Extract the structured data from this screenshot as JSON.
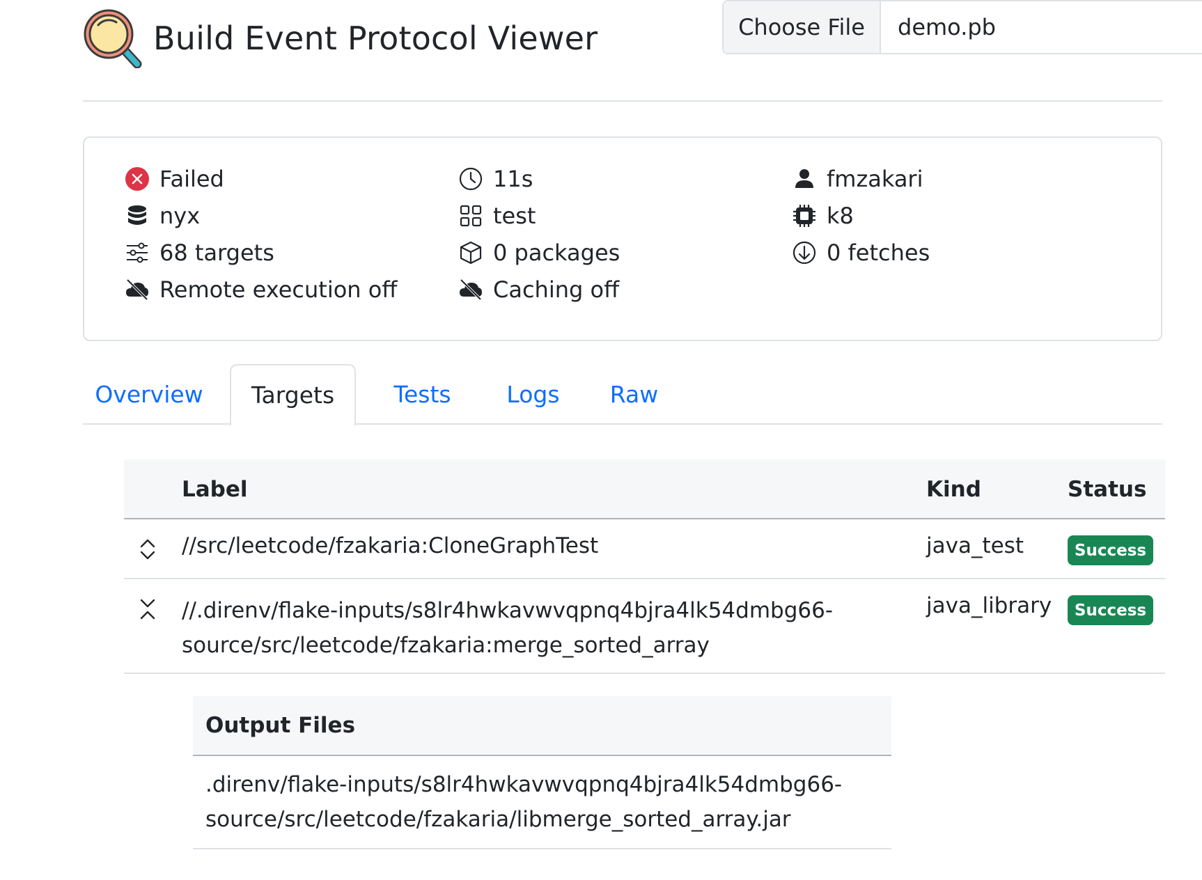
{
  "header": {
    "title": "Build Event Protocol Viewer",
    "logo_icon": "magnifier-logo-icon",
    "file_input": {
      "button_label": "Choose File",
      "file_name": "demo.pb"
    }
  },
  "summary": {
    "status": {
      "text": "Failed",
      "icon": "error-circle-icon",
      "color": "#dc3545"
    },
    "duration": {
      "text": "11s",
      "icon": "clock-icon"
    },
    "user": {
      "text": "fmzakari",
      "icon": "person-icon"
    },
    "host": {
      "text": "nyx",
      "icon": "database-icon"
    },
    "command": {
      "text": "test",
      "icon": "grid-icon"
    },
    "cpu": {
      "text": "k8",
      "icon": "cpu-icon"
    },
    "targets": {
      "text": "68 targets",
      "icon": "sliders-icon"
    },
    "packages": {
      "text": "0 packages",
      "icon": "box-icon"
    },
    "fetches": {
      "text": "0 fetches",
      "icon": "download-circle-icon"
    },
    "remote_execution": {
      "text": "Remote execution off",
      "icon": "cloud-slash-icon"
    },
    "caching": {
      "text": "Caching off",
      "icon": "cloud-slash-icon"
    }
  },
  "tabs": [
    {
      "label": "Overview",
      "active": false
    },
    {
      "label": "Targets",
      "active": true
    },
    {
      "label": "Tests",
      "active": false
    },
    {
      "label": "Logs",
      "active": false
    },
    {
      "label": "Raw",
      "active": false
    }
  ],
  "targets_table": {
    "columns": {
      "label": "Label",
      "kind": "Kind",
      "status": "Status"
    },
    "rows": [
      {
        "label": "//src/leetcode/fzakaria:CloneGraphTest",
        "kind": "java_test",
        "status": "Success",
        "toggle_icon": "expand-chevrons-icon"
      },
      {
        "label_line1": "//.direnv/flake-inputs/s8lr4hwkavwvqpnq4bjra4lk54dmbg66-",
        "label_line2": "source/src/leetcode/fzakaria:merge_sorted_array",
        "kind": "java_library",
        "status": "Success",
        "toggle_icon": "collapse-chevrons-icon"
      }
    ],
    "status_color": "#198754"
  },
  "output_files": {
    "title": "Output Files",
    "files": [
      {
        "line1": ".direnv/flake-inputs/s8lr4hwkavwvqpnq4bjra4lk54dmbg66-",
        "line2": "source/src/leetcode/fzakaria/libmerge_sorted_array.jar"
      }
    ]
  }
}
